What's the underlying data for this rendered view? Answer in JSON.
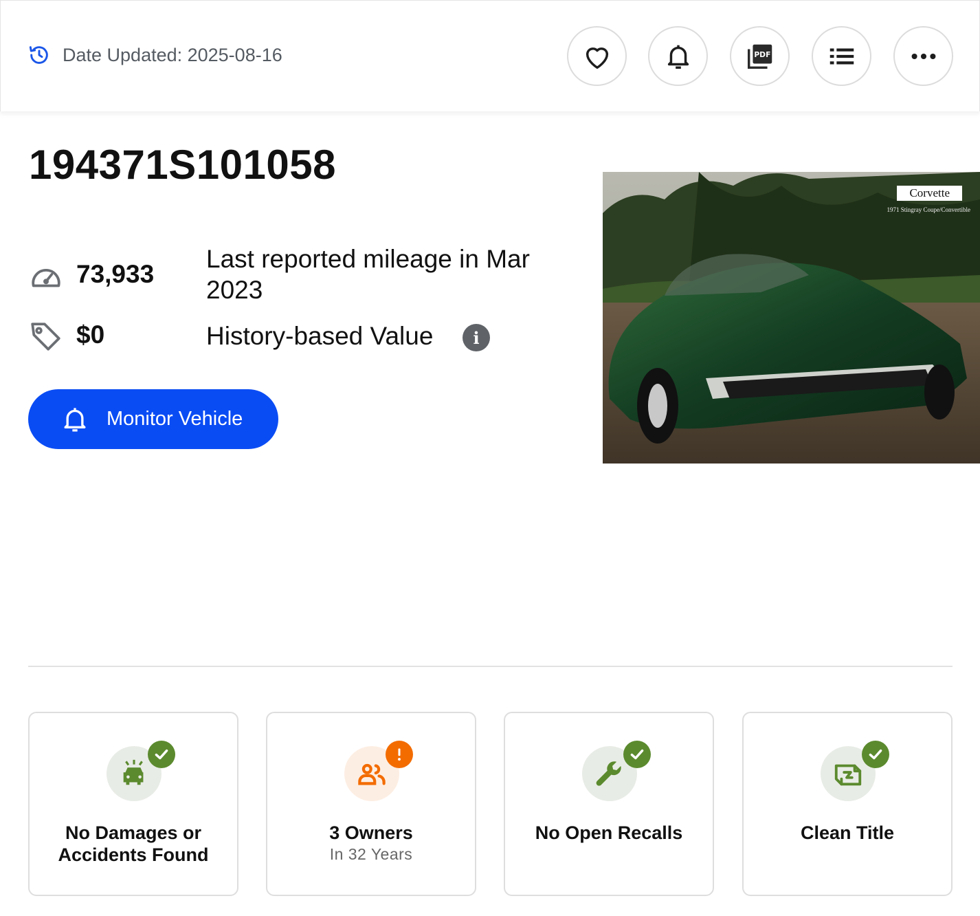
{
  "header": {
    "date_updated": "Date Updated: 2025-08-16",
    "buttons": [
      {
        "icon": "heart-icon",
        "name": "favorite-button"
      },
      {
        "icon": "bell-icon",
        "name": "alert-button"
      },
      {
        "icon": "pdf-icon",
        "name": "pdf-button"
      },
      {
        "icon": "list-icon",
        "name": "list-button"
      },
      {
        "icon": "more-icon",
        "name": "more-button"
      }
    ]
  },
  "vehicle": {
    "vin": "194371S101058",
    "mileage": {
      "value": "73,933",
      "label_line1": "Last reported mileage in Mar",
      "label_line2": "2023"
    },
    "value": {
      "amount": "$0",
      "label": "History-based Value",
      "info_glyph": "i"
    },
    "monitor_button": "Monitor Vehicle",
    "image": {
      "brand_text": "Corvette",
      "caption": "1971 Stingray Coupe/Convertible"
    }
  },
  "cards": [
    {
      "title_line1": "No Damages or",
      "title_line2": "Accidents Found",
      "subtitle": "",
      "status": "ok",
      "icon": "car-crash-icon"
    },
    {
      "title_line1": "3 Owners",
      "title_line2": "",
      "subtitle": "In 32 Years",
      "status": "warning",
      "icon": "owners-icon"
    },
    {
      "title_line1": "No Open Recalls",
      "title_line2": "",
      "subtitle": "",
      "status": "ok",
      "icon": "wrench-icon"
    },
    {
      "title_line1": "Clean Title",
      "title_line2": "",
      "subtitle": "",
      "status": "ok",
      "icon": "title-document-icon"
    }
  ],
  "colors": {
    "primary_blue": "#0a4cf4",
    "ok_green": "#5b8a2e",
    "warning_orange": "#f36c00",
    "ok_bg": "#e8ece6",
    "warning_bg": "#fdeee3"
  }
}
